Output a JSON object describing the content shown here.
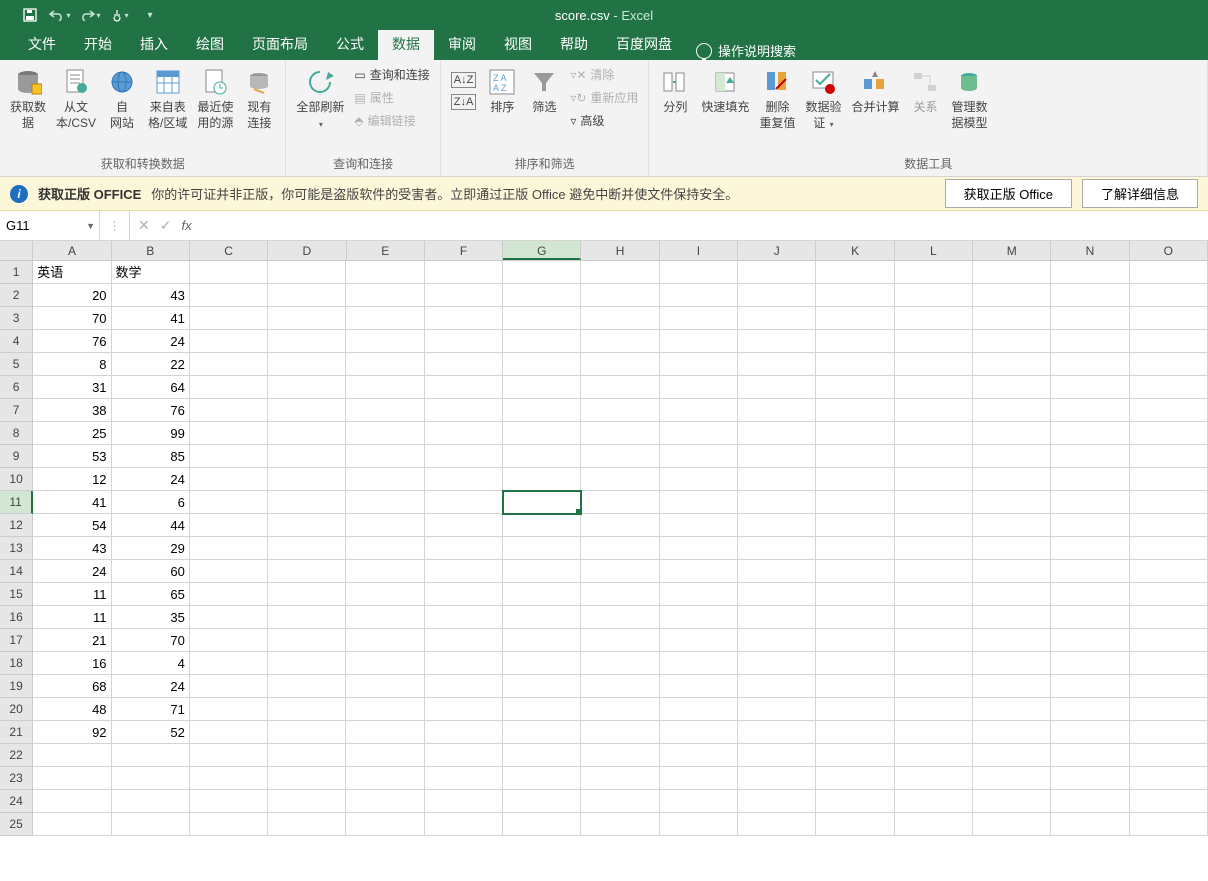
{
  "title": {
    "filename": "score.csv",
    "app": "Excel",
    "separator": " - "
  },
  "tabs": {
    "file": "文件",
    "home": "开始",
    "insert": "插入",
    "draw": "绘图",
    "layout": "页面布局",
    "formulas": "公式",
    "data": "数据",
    "review": "审阅",
    "view": "视图",
    "help": "帮助",
    "baidu": "百度网盘",
    "tellme": "操作说明搜索"
  },
  "ribbon": {
    "group_get": {
      "label": "获取和转换数据",
      "get_data": "获取数\n据",
      "from_csv": "从文\n本/CSV",
      "from_web": "自\n网站",
      "from_table": "来自表\n格/区域",
      "recent": "最近使\n用的源",
      "existing": "现有\n连接"
    },
    "group_query": {
      "label": "查询和连接",
      "refresh_all": "全部刷新",
      "queries": "查询和连接",
      "properties": "属性",
      "edit_links": "编辑链接"
    },
    "group_sort": {
      "label": "排序和筛选",
      "sort": "排序",
      "filter": "筛选",
      "clear": "清除",
      "reapply": "重新应用",
      "advanced": "高级"
    },
    "group_tools": {
      "label": "数据工具",
      "text_cols": "分列",
      "flash_fill": "快速填充",
      "remove_dup": "删除\n重复值",
      "validation": "数据验\n证",
      "consolidate": "合并计算",
      "relationships": "关系",
      "data_model": "管理数\n据模型"
    }
  },
  "banner": {
    "title": "获取正版 OFFICE",
    "msg": "你的许可证并非正版，你可能是盗版软件的受害者。立即通过正版 Office 避免中断并使文件保持安全。",
    "btn1": "获取正版 Office",
    "btn2": "了解详细信息"
  },
  "namebox": "G11",
  "columns": [
    "A",
    "B",
    "C",
    "D",
    "E",
    "F",
    "G",
    "H",
    "I",
    "J",
    "K",
    "L",
    "M",
    "N",
    "O"
  ],
  "selected_cell": {
    "row": 11,
    "col": "G",
    "colIndex": 6
  },
  "sheet": {
    "headers": [
      "英语",
      "数学"
    ],
    "rows": [
      [
        20,
        43
      ],
      [
        70,
        41
      ],
      [
        76,
        24
      ],
      [
        8,
        22
      ],
      [
        31,
        64
      ],
      [
        38,
        76
      ],
      [
        25,
        99
      ],
      [
        53,
        85
      ],
      [
        12,
        24
      ],
      [
        41,
        6
      ],
      [
        54,
        44
      ],
      [
        43,
        29
      ],
      [
        24,
        60
      ],
      [
        11,
        65
      ],
      [
        11,
        35
      ],
      [
        21,
        70
      ],
      [
        16,
        4
      ],
      [
        68,
        24
      ],
      [
        48,
        71
      ],
      [
        92,
        52
      ]
    ]
  },
  "visible_rows": 25
}
